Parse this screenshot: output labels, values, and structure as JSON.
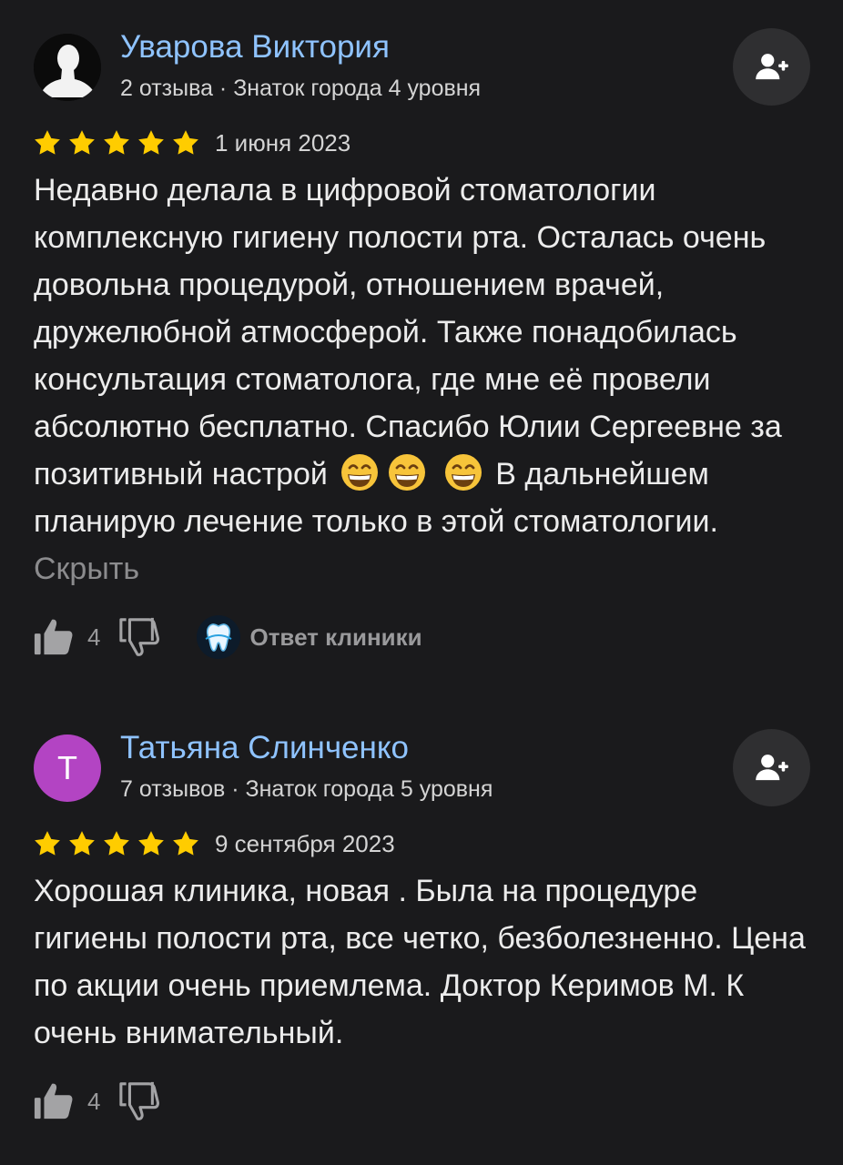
{
  "reviews": [
    {
      "author_name": "Уварова Виктория",
      "author_meta": "2 отзыва · Знаток города 4 уровня",
      "avatar_type": "photo",
      "rating": 5,
      "date": "1 июня 2023",
      "text_part1": "Недавно делала в цифровой стоматологии комплексную гигиену полости рта. Осталась очень довольна процедурой, отношением врачей, дружелюбной атмосферой. Также понадобилась консультация стоматолога, где мне её провели абсолютно бесплатно. Спасибо Юлии Сергеевне за позитивный настрой",
      "emoji": "grinning-face-with-smiling-eyes",
      "emoji_count": 3,
      "text_part2": "В дальнейшем планирую лечение только в этой стоматологии.",
      "hide_label": "Скрыть",
      "likes": "4",
      "clinic_reply_label": "Ответ клиники"
    },
    {
      "author_name": "Татьяна Слинченко",
      "author_meta": "7 отзывов · Знаток города 5 уровня",
      "avatar_letter": "Т",
      "avatar_color": "#b344c3",
      "rating": 5,
      "date": "9 сентября 2023",
      "text": "Хорошая клиника, новая . Была на процедуре гигиены полости рта, все четко, безболезненно. Цена по акции очень приемлема. Доктор Керимов М. К очень внимательный.",
      "likes": "4"
    }
  ],
  "colors": {
    "background": "#1a1a1c",
    "author_name": "#8fc3ff",
    "star": "#ffcc00",
    "muted": "#9a9a9c"
  },
  "icons": {
    "follow": "add-user-icon",
    "like": "thumb-up-icon",
    "dislike": "thumb-down-icon",
    "clinic": "tooth-logo-icon"
  }
}
